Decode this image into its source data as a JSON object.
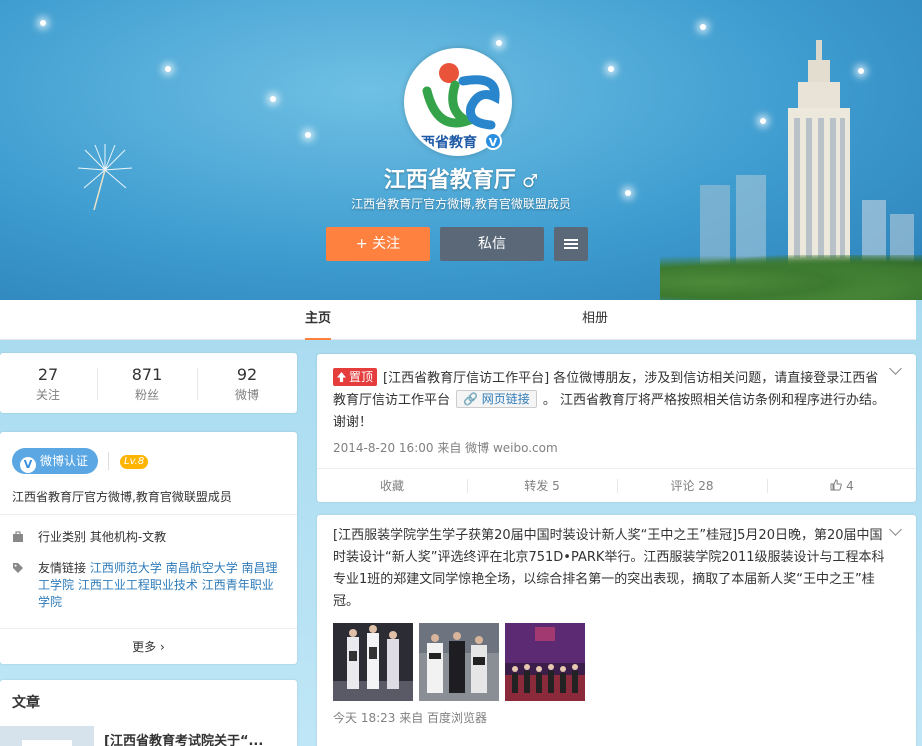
{
  "profile": {
    "name": "江西省教育厅",
    "gender_symbol": "♂",
    "description": "江西省教育厅官方微博,教育官微联盟成员",
    "avatar_text": "西省教育",
    "follow_label": "+ 关注",
    "message_label": "私信"
  },
  "tabs": [
    {
      "label": "主页"
    },
    {
      "label": "相册"
    }
  ],
  "stats": [
    {
      "value": "27",
      "label": "关注"
    },
    {
      "value": "871",
      "label": "粉丝"
    },
    {
      "value": "92",
      "label": "微博"
    }
  ],
  "info": {
    "verify_label": "微博认证",
    "verify_letter": "V",
    "level": "Lv.8",
    "description": "江西省教育厅官方微博,教育官微联盟成员",
    "industry_label": "行业类别",
    "industry_value": "其他机构-文教",
    "links_label": "友情链接",
    "links": [
      "江西师范大学",
      "南昌航空大学",
      "南昌理工学院",
      "江西工业工程职业技术",
      "江西青年职业学院"
    ],
    "more_label": "更多"
  },
  "articles": {
    "heading": "文章",
    "first_title": "[江西省教育考试院关于“..."
  },
  "posts": [
    {
      "top_badge": "置顶",
      "text_before": "[江西省教育厅信访工作平台] 各位微博朋友，涉及到信访相关问题，请直接登录江西省教育厅信访工作平台",
      "link_label": "网页链接",
      "text_after": "。 江西省教育厅将严格按照相关信访条例和程序进行办结。谢谢！",
      "meta": "2014-8-20 16:00 来自 微博 weibo.com",
      "actions": {
        "favorite": "收藏",
        "repost": "转发 5",
        "comment": "评论 28",
        "like": "4"
      }
    },
    {
      "text": "[江西服装学院学生学子获第20届中国时装设计新人奖“王中之王”桂冠]5月20日晚，第20届中国时装设计“新人奖”评选终评在北京751D•PARK举行。江西服装学院2011级服装设计与工程本科专业1班的郑建文同学惊艳全场，以综合排名第一的突出表现，摘取了本届新人奖“王中之王”桂冠。",
      "meta": "今天 18:23 来自 百度浏览器"
    }
  ],
  "colors": {
    "accent": "#ff8140",
    "dark_button": "#5b6877",
    "top_badge": "#e53c3c",
    "link": "#2e7bb9",
    "level": "#ffb400"
  }
}
